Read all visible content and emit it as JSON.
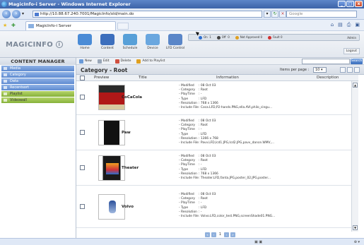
{
  "window": {
    "title": "MagicInfo-i Server - Windows Internet Explorer",
    "buttons": [
      "_",
      "□",
      "x"
    ]
  },
  "address": {
    "url": "http://10.88.67.240:7001/MagicInfo/old/main.do",
    "search_placeholder": "Google"
  },
  "tab": {
    "label": "MagicInfo-i Server"
  },
  "app": {
    "logo": "MAGICINFO",
    "logo_suffix": "i",
    "nav": [
      {
        "label": "Home",
        "color": "#4a8bd6"
      },
      {
        "label": "Content",
        "color": "#3d6fbd"
      },
      {
        "label": "Schedule",
        "color": "#58a0d8"
      },
      {
        "label": "Device",
        "color": "#6aa7df"
      },
      {
        "label": "LFD Control",
        "color": "#5a86c8"
      }
    ],
    "status": [
      {
        "label": "On",
        "value": "1",
        "color": "#2f6fd0"
      },
      {
        "label": "Off",
        "value": "0",
        "color": "#444444"
      },
      {
        "label": "Not Approved",
        "value": "0",
        "color": "#e0a020"
      },
      {
        "label": "Fault",
        "value": "0",
        "color": "#d03030"
      }
    ],
    "status_tail": "Admin",
    "logout": "Logout"
  },
  "sidebar": {
    "title": "CONTENT MANAGER",
    "items": [
      {
        "label": "Media",
        "style": "blue"
      },
      {
        "label": "Category",
        "style": "blue"
      },
      {
        "label": "Data",
        "style": "blue"
      },
      {
        "label": "Recentsort",
        "style": "blue"
      },
      {
        "label": "Playlist",
        "style": "green"
      },
      {
        "label": "Videowall",
        "style": "green"
      }
    ]
  },
  "toolbar": {
    "new": "New",
    "edit": "Edit",
    "delete": "Delete",
    "add_to_playlist": "Add to Playlist",
    "search_button": "Search"
  },
  "category": {
    "title": "Category - Root",
    "items_per_page_label": "Items per page :",
    "items_per_page": "10"
  },
  "columns": {
    "preview": "Preview",
    "title": "Title",
    "information": "Information",
    "description": "Description"
  },
  "info_keys": [
    "- Modified",
    "- Category",
    "- PlayTime",
    "- Type",
    "- Resolution",
    "- Include File"
  ],
  "rows": [
    {
      "title": "CoCaCola",
      "modified": ": 08 Oct 03",
      "category": ": Root",
      "playtime": ": -",
      "type": ": LFD",
      "resolution": ": 768 x 1366",
      "include": ": Coca.LFD,P2-hands.PNG,ella.AVI,philo_cingu..."
    },
    {
      "title": "Paw",
      "modified": ": 08 Oct 03",
      "category": ": Root",
      "playtime": ": -",
      "type": ": LFD",
      "resolution": ": 1366 x 768",
      "include": ": Pavv.LFD,lcd1.JPG,lcd2.JPG,pavv_dance.WMV,..."
    },
    {
      "title": "Theater",
      "modified": ": 08 Oct 03",
      "category": ": Root",
      "playtime": ": -",
      "type": ": LFD",
      "resolution": ": 768 x 1366",
      "include": ": Theater.LFD,fanta.JPG,poster_02.JPG,poster..."
    },
    {
      "title": "Volvo",
      "modified": ": 08 Oct 03",
      "category": ": Root",
      "playtime": ": -",
      "type": ": LFD",
      "resolution": ": -",
      "include": ": Volvo.LFD,color_test.PNG,screenShade01.PNG..."
    }
  ],
  "pager": {
    "current": "1"
  }
}
